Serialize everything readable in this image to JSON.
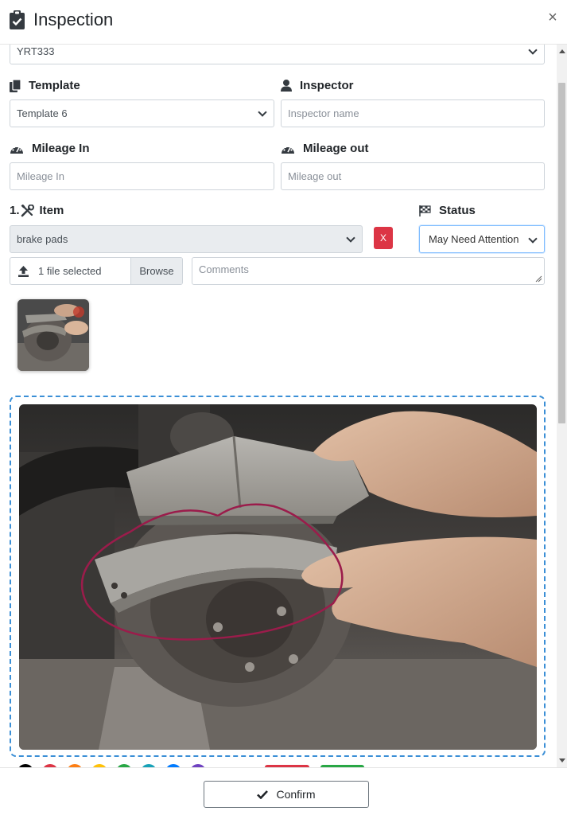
{
  "header": {
    "title": "Inspection",
    "close_label": "×"
  },
  "vehicle": {
    "value": "YRT333"
  },
  "template": {
    "label": "Template",
    "value": "Template 6"
  },
  "inspector": {
    "label": "Inspector",
    "placeholder": "Inspector name"
  },
  "mileage_in": {
    "label": "Mileage In",
    "placeholder": "Mileage In"
  },
  "mileage_out": {
    "label": "Mileage out",
    "placeholder": "Mileage out"
  },
  "item": {
    "number": "1.",
    "label": "Item",
    "value": "brake pads",
    "remove_label": "X"
  },
  "status": {
    "label": "Status",
    "value": "May Need Attention"
  },
  "upload": {
    "file_text": "1 file selected",
    "browse_label": "Browse",
    "comments_placeholder": "Comments"
  },
  "palette": {
    "colors": [
      "#000000",
      "#dc3545",
      "#fd7e14",
      "#ffc107",
      "#28a745",
      "#17a2b8",
      "#007bff",
      "#6f42c1"
    ]
  },
  "footer": {
    "confirm_label": "Confirm"
  }
}
